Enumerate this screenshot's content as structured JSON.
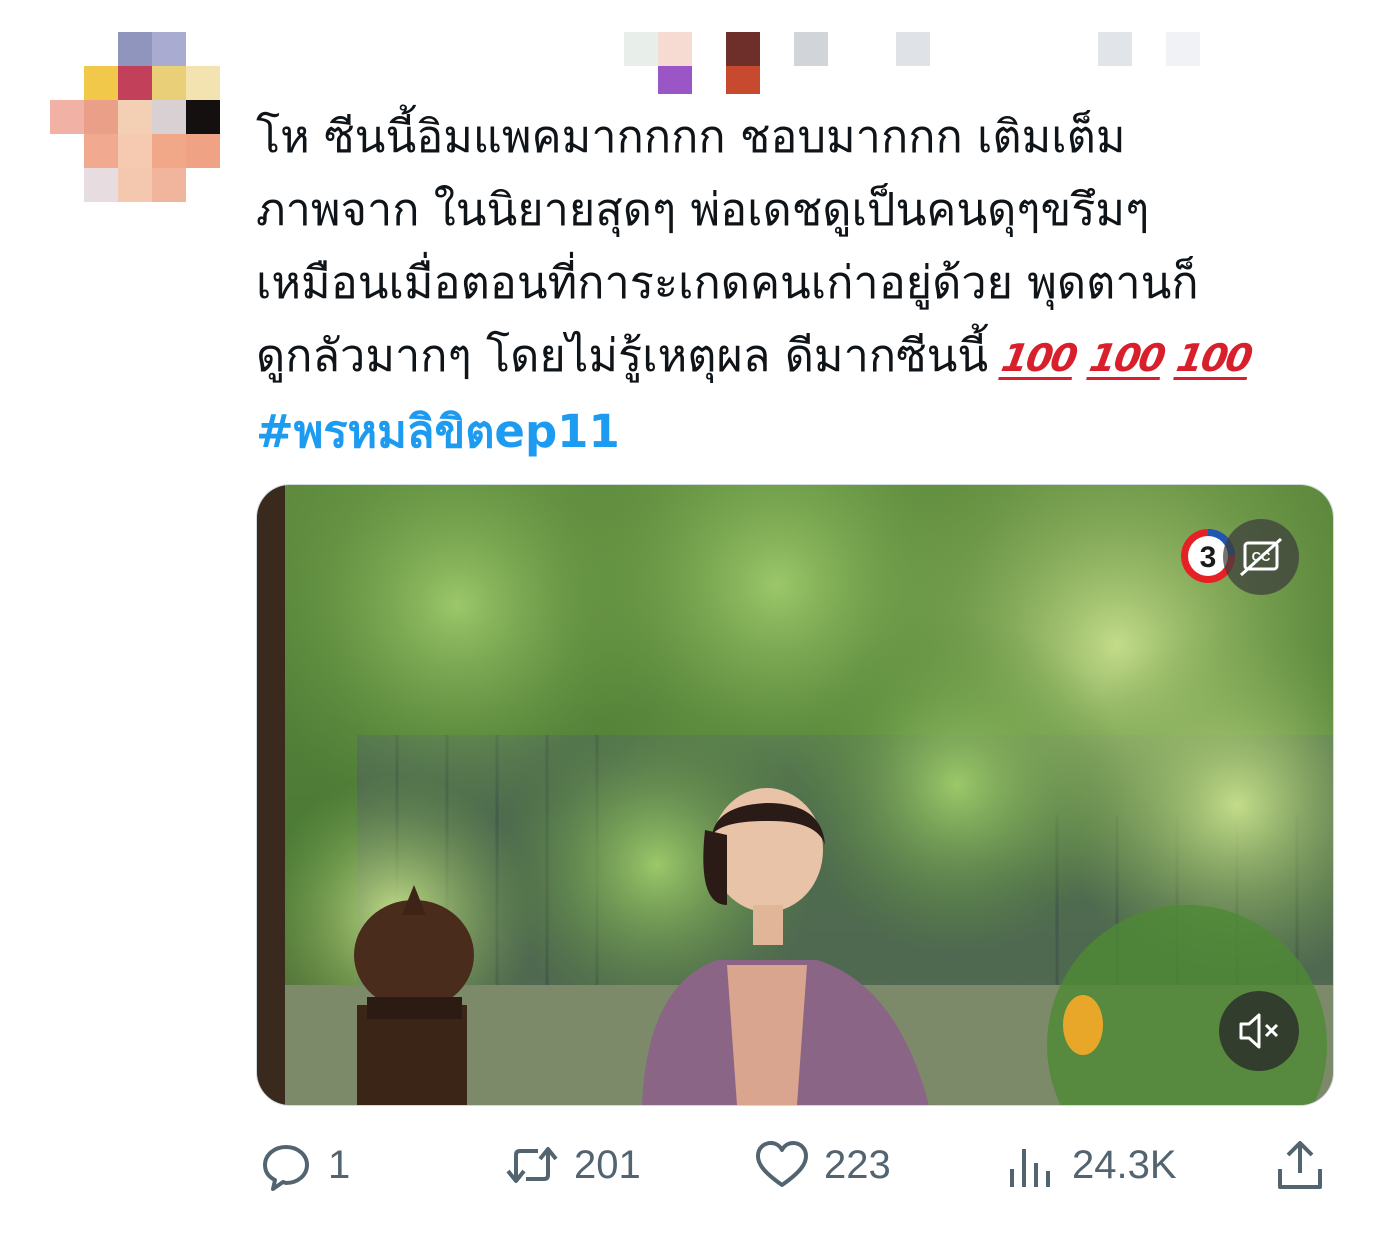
{
  "tweet": {
    "text_lines": [
      "โห ซีนนี้อิมแพคมากกกก ชอบมากกก เติมเต็ม",
      "ภาพจาก ในนิยายสุดๆ พ่อเดชดูเป็นคนดุๆขรึมๆ",
      "เหมือนเมื่อตอนที่การะเกดคนเก่าอยู่ด้วย พุดตานก็",
      "ดูกลัวมากๆ โดยไม่รู้เหตุผล ดีมากซีนนี้"
    ],
    "emoji": [
      "100",
      "100",
      "100"
    ],
    "hashtag": "#พรหมลิขิตep11"
  },
  "media": {
    "channel_logo_text": "3",
    "cc_icon": "captions-off-icon",
    "mute_icon": "muted-speaker-icon"
  },
  "actions": {
    "reply": {
      "icon": "reply-bubble-icon",
      "count": "1"
    },
    "retweet": {
      "icon": "retweet-icon",
      "count": "201"
    },
    "like": {
      "icon": "heart-icon",
      "count": "223"
    },
    "views": {
      "icon": "views-bar-chart-icon",
      "count": "24.3K"
    },
    "share": {
      "icon": "share-upload-icon"
    }
  },
  "colors": {
    "text": "#0f1419",
    "hashtag": "#1d9bf0",
    "secondary": "#536471",
    "emoji_red": "#d8202c"
  }
}
